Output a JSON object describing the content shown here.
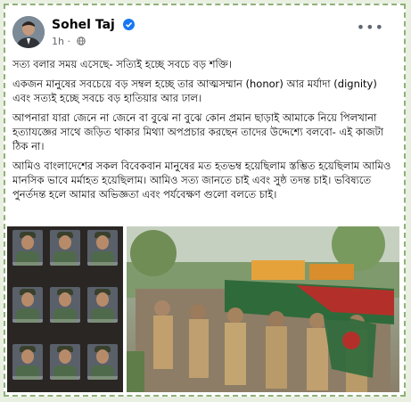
{
  "author": {
    "name": "Sohel Taj",
    "time": "1h",
    "verified_icon": "verified-badge-icon",
    "privacy_icon": "globe-icon"
  },
  "menu": {
    "more_label": "•••"
  },
  "post": {
    "paragraphs": [
      "সত্য বলার সময় এসেছে- সত্যিই হচ্ছে সবচে বড় শক্তি।",
      "একজন মানুষের সবচেয়ে বড় সম্বল হচ্ছে তার আত্মসম্মান (honor) আর মর্যাদা (dignity) এবং সত্যই হচ্ছে সবচে বড় হাতিয়ার আর ঢাল।",
      "আপনারা যারা জেনে না জেনে বা বুঝে না বুঝে কোন প্রমান ছাড়াই আমাকে নিয়ে পিলখানা হত্যাযজ্ঞের সাথে জড়িত থাকার মিথ্যা অপপ্রচার করছেন তাদের উদ্দেশ্যে বলবো- এই কাজটা ঠিক না।",
      "আমিও বাংলাদেশের সকল বিবেকবান মানুষের মত হতভম্ব হয়েছিলাম স্তম্ভিত হয়েছিলাম আমিও মানসিক ভাবে মর্মাহত হয়েছিলাম। আমিও সত্য জানতে চাই এবং সুষ্ঠ তদন্ত চাই। ভবিষ্যতে পুনর্তদন্ত হলে আমার অভিজ্ঞতা এবং পর্যবেক্ষণ গুলো বলতে চাই।"
    ]
  },
  "colors": {
    "frame_border": "#8fb07a",
    "page_bg": "#e9f0e2",
    "verified": "#1877f2"
  }
}
